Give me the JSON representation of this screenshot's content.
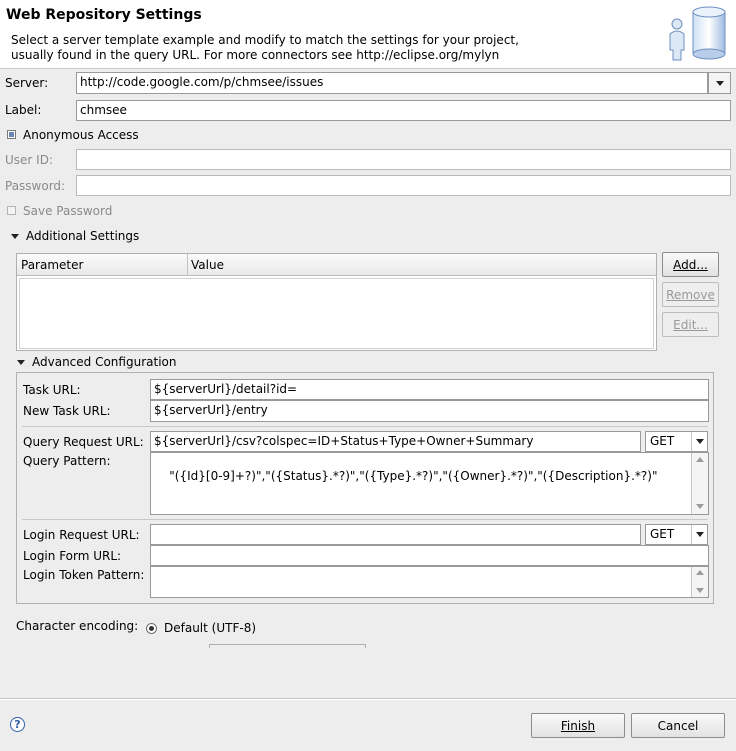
{
  "header": {
    "title": "Web Repository Settings",
    "description_line1": "Select a server template example and modify to match the settings for your project,",
    "description_line2": "usually found in the query URL.  For more connectors see http://eclipse.org/mylyn",
    "illustration_icon": "repository-database-person-icon"
  },
  "fields": {
    "server_label": "Server:",
    "server_value": "http://code.google.com/p/chmsee/issues",
    "label_label": "Label:",
    "label_value": "chmsee",
    "anonymous_label": "Anonymous Access",
    "anonymous_checked": true,
    "userid_label": "User ID:",
    "password_label": "Password:",
    "save_password_label": "Save Password",
    "save_password_checked": false
  },
  "additional": {
    "section_label": "Additional Settings",
    "columns": [
      "Parameter",
      "Value"
    ],
    "rows": [],
    "add_label": "Add...",
    "remove_label": "Remove",
    "edit_label": "Edit..."
  },
  "advanced": {
    "section_label": "Advanced Configuration",
    "task_url_label": "Task URL:",
    "task_url_value": "${serverUrl}/detail?id=",
    "new_task_url_label": "New Task URL:",
    "new_task_url_value": "${serverUrl}/entry",
    "query_request_label": "Query Request URL:",
    "query_request_value": "${serverUrl}/csv?colspec=ID+Status+Type+Owner+Summary",
    "query_method": "GET",
    "query_pattern_label": "Query Pattern:",
    "query_pattern_value": "\"({Id}[0-9]+?)\",\"({Status}.*?)\",\"({Type}.*?)\",\"({Owner}.*?)\",\"({Description}.*?)\"",
    "login_request_label": "Login Request URL:",
    "login_request_value": "",
    "login_method": "GET",
    "login_form_label": "Login Form URL:",
    "login_form_value": "",
    "login_token_label": "Login Token Pattern:",
    "login_token_value": ""
  },
  "encoding": {
    "label": "Character encoding:",
    "default_option": "Default (UTF-8)"
  },
  "footer": {
    "help_icon": "help-icon",
    "finish_label": "Finish",
    "cancel_label": "Cancel"
  }
}
